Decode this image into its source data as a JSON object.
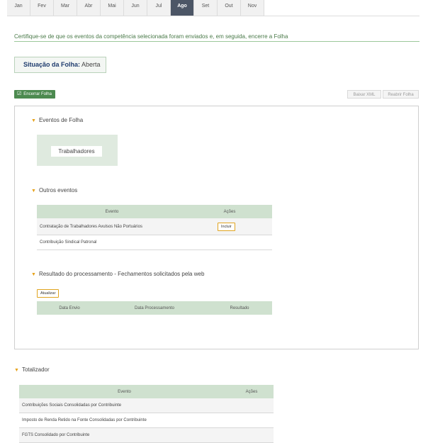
{
  "months": [
    {
      "label": "Jan",
      "active": false
    },
    {
      "label": "Fev",
      "active": false
    },
    {
      "label": "Mar",
      "active": false
    },
    {
      "label": "Abr",
      "active": false
    },
    {
      "label": "Mai",
      "active": false
    },
    {
      "label": "Jun",
      "active": false
    },
    {
      "label": "Jul",
      "active": false
    },
    {
      "label": "Ago",
      "active": true
    },
    {
      "label": "Set",
      "active": false
    },
    {
      "label": "Out",
      "active": false
    },
    {
      "label": "Nov",
      "active": false
    }
  ],
  "instruction": "Certifique-se de que os eventos da competência selecionada foram enviados e, em seguida, encerre a Folha",
  "status": {
    "label": "Situação da Folha:",
    "value": "Aberta"
  },
  "toolbar": {
    "encerrar": "Encerrar Folha",
    "baixar": "Baixar XML",
    "reabrir": "Reabrir Folha"
  },
  "eventos_folha": {
    "title": "Eventos de Folha",
    "button": "Trabalhadores"
  },
  "outros_eventos": {
    "title": "Outros eventos",
    "headers": [
      "Evento",
      "Ações"
    ],
    "rows": [
      {
        "evento": "Contratação de Trabalhadores Avulsos Não Portuários",
        "acao": "Incluir"
      },
      {
        "evento": "Contribuição Sindical Patronal",
        "acao": ""
      }
    ]
  },
  "resultado": {
    "title": "Resultado do processamento - Fechamentos solicitados pela web",
    "button": "Atualizar",
    "headers": [
      "Data Envio",
      "Data Processamento",
      "Resultado"
    ]
  },
  "totalizador": {
    "title": "Totalizador",
    "headers": [
      "Evento",
      "Ações"
    ],
    "rows": [
      "Contribuições Sociais Consolidadas por Contribuinte",
      "Imposto de Renda Retido na Fonte Consolidadas por Contribuinte",
      "FGTS Consolidado por Contribuinte"
    ]
  },
  "colors": {
    "accent": "#4c8a4f",
    "tab_active": "#4c5666",
    "header_green": "#cfe1cf",
    "triangle": "#e6a21b"
  }
}
